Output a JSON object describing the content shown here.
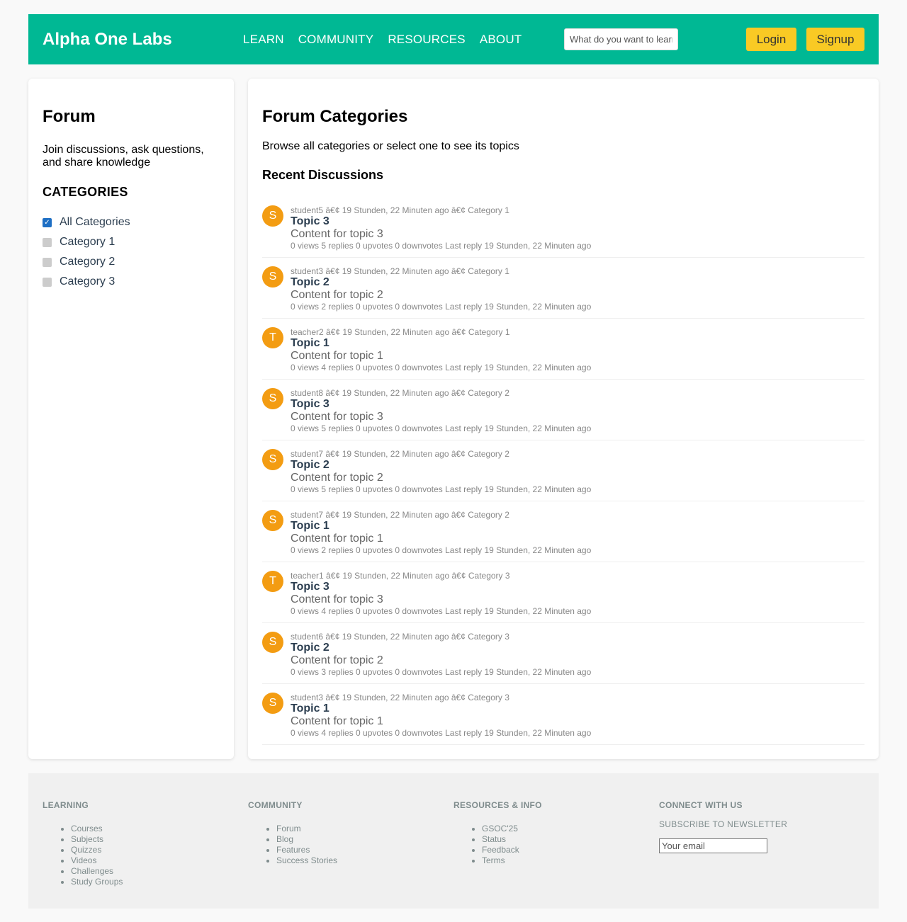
{
  "header": {
    "logo": "Alpha One Labs",
    "nav": [
      "LEARN",
      "COMMUNITY",
      "RESOURCES",
      "ABOUT"
    ],
    "search_placeholder": "What do you want to learn?",
    "login_label": "Login",
    "signup_label": "Signup",
    "colors": {
      "header_bg": "#00b894",
      "button_bg": "#f9ca24"
    }
  },
  "sidebar": {
    "title": "Forum",
    "description": "Join discussions, ask questions, and share knowledge",
    "categories_heading": "CATEGORIES",
    "categories": [
      {
        "label": "All Categories",
        "checked": true
      },
      {
        "label": "Category 1",
        "checked": false
      },
      {
        "label": "Category 2",
        "checked": false
      },
      {
        "label": "Category 3",
        "checked": false
      }
    ]
  },
  "main": {
    "title": "Forum Categories",
    "subtitle": "Browse all categories or select one to see its topics",
    "recent_heading": "Recent Discussions",
    "discussions": [
      {
        "avatar": "S",
        "meta": "student5 â€¢ 19 Stunden, 22 Minuten ago â€¢ Category 1",
        "title": "Topic 3",
        "content": "Content for topic 3",
        "stats": "0 views 5 replies 0 upvotes 0 downvotes Last reply 19 Stunden, 22 Minuten ago"
      },
      {
        "avatar": "S",
        "meta": "student3 â€¢ 19 Stunden, 22 Minuten ago â€¢ Category 1",
        "title": "Topic 2",
        "content": "Content for topic 2",
        "stats": "0 views 2 replies 0 upvotes 0 downvotes Last reply 19 Stunden, 22 Minuten ago"
      },
      {
        "avatar": "T",
        "meta": "teacher2 â€¢ 19 Stunden, 22 Minuten ago â€¢ Category 1",
        "title": "Topic 1",
        "content": "Content for topic 1",
        "stats": "0 views 4 replies 0 upvotes 0 downvotes Last reply 19 Stunden, 22 Minuten ago"
      },
      {
        "avatar": "S",
        "meta": "student8 â€¢ 19 Stunden, 22 Minuten ago â€¢ Category 2",
        "title": "Topic 3",
        "content": "Content for topic 3",
        "stats": "0 views 5 replies 0 upvotes 0 downvotes Last reply 19 Stunden, 22 Minuten ago"
      },
      {
        "avatar": "S",
        "meta": "student7 â€¢ 19 Stunden, 22 Minuten ago â€¢ Category 2",
        "title": "Topic 2",
        "content": "Content for topic 2",
        "stats": "0 views 5 replies 0 upvotes 0 downvotes Last reply 19 Stunden, 22 Minuten ago"
      },
      {
        "avatar": "S",
        "meta": "student7 â€¢ 19 Stunden, 22 Minuten ago â€¢ Category 2",
        "title": "Topic 1",
        "content": "Content for topic 1",
        "stats": "0 views 2 replies 0 upvotes 0 downvotes Last reply 19 Stunden, 22 Minuten ago"
      },
      {
        "avatar": "T",
        "meta": "teacher1 â€¢ 19 Stunden, 22 Minuten ago â€¢ Category 3",
        "title": "Topic 3",
        "content": "Content for topic 3",
        "stats": "0 views 4 replies 0 upvotes 0 downvotes Last reply 19 Stunden, 22 Minuten ago"
      },
      {
        "avatar": "S",
        "meta": "student6 â€¢ 19 Stunden, 22 Minuten ago â€¢ Category 3",
        "title": "Topic 2",
        "content": "Content for topic 2",
        "stats": "0 views 3 replies 0 upvotes 0 downvotes Last reply 19 Stunden, 22 Minuten ago"
      },
      {
        "avatar": "S",
        "meta": "student3 â€¢ 19 Stunden, 22 Minuten ago â€¢ Category 3",
        "title": "Topic 1",
        "content": "Content for topic 1",
        "stats": "0 views 4 replies 0 upvotes 0 downvotes Last reply 19 Stunden, 22 Minuten ago"
      }
    ]
  },
  "footer": {
    "learning": {
      "heading": "LEARNING",
      "links": [
        "Courses",
        "Subjects",
        "Quizzes",
        "Videos",
        "Challenges",
        "Study Groups"
      ]
    },
    "community": {
      "heading": "COMMUNITY",
      "links": [
        "Forum",
        "Blog",
        "Features",
        "Success Stories"
      ]
    },
    "resources": {
      "heading": "RESOURCES & INFO",
      "links": [
        "GSOC'25",
        "Status",
        "Feedback",
        "Terms"
      ]
    },
    "connect": {
      "heading": "CONNECT WITH US",
      "newsletter": "SUBSCRIBE TO NEWSLETTER",
      "email_placeholder": "Your email"
    }
  }
}
